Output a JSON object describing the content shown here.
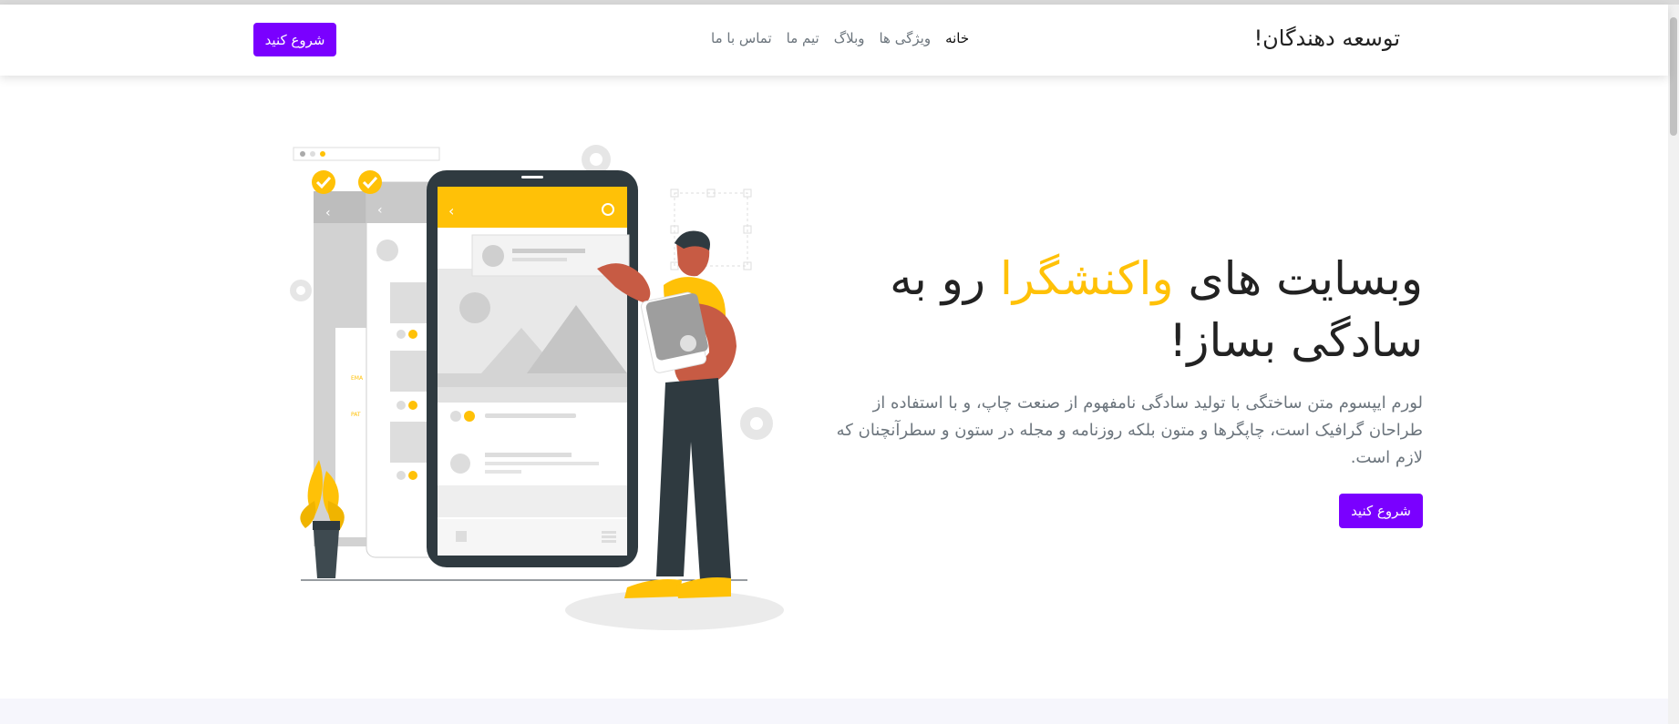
{
  "navbar": {
    "brand": "توسعه دهندگان!",
    "links": [
      "خانه",
      "ویژگی ها",
      "وبلاگ",
      "تیم ما",
      "تماس با ما"
    ],
    "cta": "شروع کنید"
  },
  "hero": {
    "title_part1": "وبسایت های ",
    "title_accent": "واکنشگرا",
    "title_part2": " رو به سادگی بساز!",
    "description": "لورم ایپسوم متن ساختگی با تولید سادگی نامفهوم از صنعت چاپ، و با استفاده از طراحان گرافیک است، چاپگرها و متون بلکه روزنامه و مجله در ستون و سطرآنچنان که لازم است.",
    "cta": "شروع کنید"
  },
  "colors": {
    "primary": "#7a00ff",
    "accent": "#ffc107",
    "phone_frame": "#2f3a40",
    "person_skin": "#c75b44"
  }
}
